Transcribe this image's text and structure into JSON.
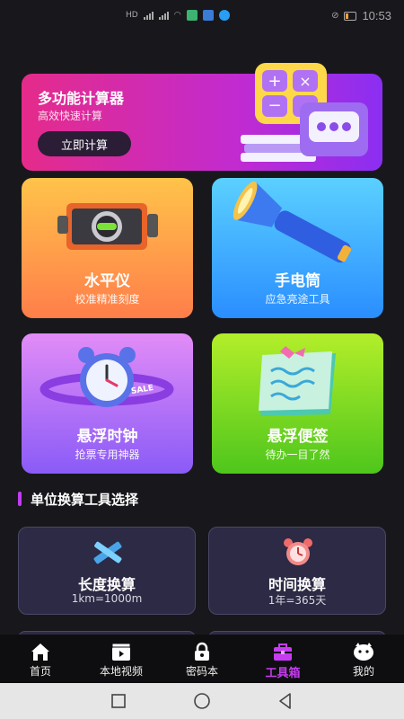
{
  "status_bar": {
    "left_text": "HD",
    "time": "10:53"
  },
  "banner": {
    "title": "多功能计算器",
    "subtitle": "高效快速计算",
    "button_label": "立即计算"
  },
  "tools": [
    {
      "title": "水平仪",
      "subtitle": "校准精准刻度"
    },
    {
      "title": "手电筒",
      "subtitle": "应急亮途工具"
    },
    {
      "title": "悬浮时钟",
      "subtitle": "抢票专用神器",
      "badge": "SALE"
    },
    {
      "title": "悬浮便签",
      "subtitle": "待办一目了然"
    }
  ],
  "converter_section": {
    "title": "单位换算工具选择",
    "items": [
      {
        "title": "长度换算",
        "subtitle": "1km=1000m"
      },
      {
        "title": "时间换算",
        "subtitle": "1年=365天"
      }
    ]
  },
  "bottom_nav": {
    "items": [
      {
        "label": "首页",
        "icon": "home-icon"
      },
      {
        "label": "本地视频",
        "icon": "video-icon"
      },
      {
        "label": "密码本",
        "icon": "lock-icon"
      },
      {
        "label": "工具箱",
        "icon": "toolbox-icon",
        "active": true
      },
      {
        "label": "我的",
        "icon": "profile-icon"
      }
    ]
  },
  "colors": {
    "background": "#18181c",
    "accent": "#c63cf0",
    "banner_start": "#e52b8a",
    "banner_end": "#8b2ef2"
  }
}
